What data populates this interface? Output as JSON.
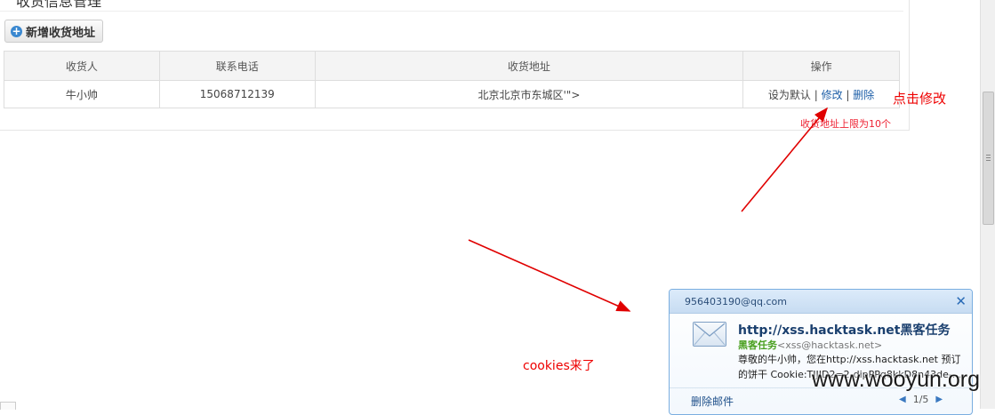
{
  "panel": {
    "title": "收货信息管理"
  },
  "toolbar": {
    "add_label": "新增收货地址",
    "add_icon": "plus-circle-icon"
  },
  "table": {
    "headers": [
      "收货人",
      "联系电话",
      "收货地址",
      "操作"
    ],
    "rows": [
      {
        "name": "牛小帅",
        "phone": "15068712139",
        "address": "北京北京市东城区'\">",
        "actions": {
          "default": "设为默认",
          "sep": "|",
          "edit": "修改",
          "delete": "删除"
        }
      }
    ],
    "limit_note": "收货地址上限为10个"
  },
  "annotations": {
    "click_edit": "点击修改",
    "cookies": "cookies来了",
    "arrow_color": "#e00000"
  },
  "notification": {
    "account": "956403190@qq.com",
    "close_icon": "close-icon",
    "mail_icon": "envelope-icon",
    "subject": "http://xss.hacktask.net黑客任务",
    "from_name": "黑客任务",
    "from_addr": "<xss@hacktask.net>",
    "body_line1": "尊敬的牛小帅，您在http://xss.hacktask.net 预订",
    "body_line2": "的饼干 Cookie:TJJID2=2-dipPPq8kkD8n43de-...",
    "delete_label": "删除邮件",
    "pager": "1/5",
    "prev_icon": "triangle-left-icon",
    "next_icon": "triangle-right-icon"
  },
  "watermark": "www.wooyun.org"
}
